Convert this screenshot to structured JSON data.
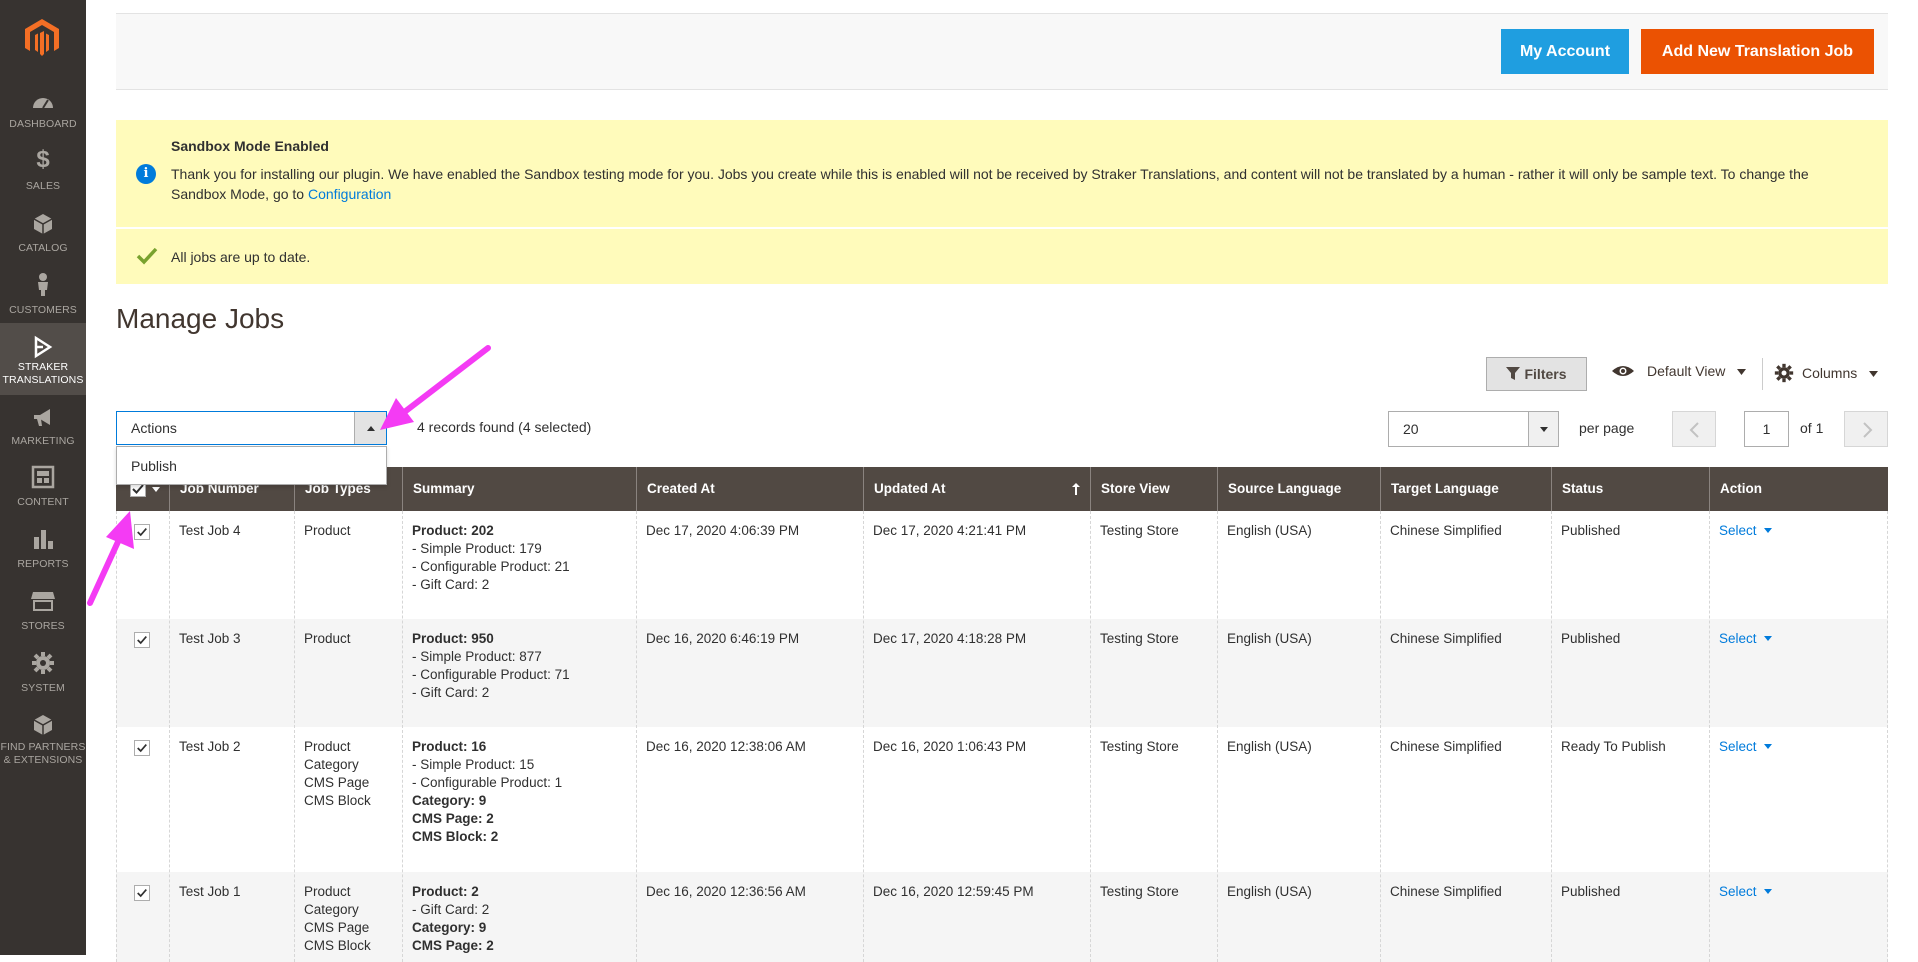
{
  "sidebar": {
    "items": [
      {
        "label": "DASHBOARD",
        "icon": "dashboard-icon"
      },
      {
        "label": "$",
        "icon": "sales-icon"
      },
      {
        "label": "SALES",
        "icon": "sales-icon"
      },
      {
        "label": "CATALOG",
        "icon": "catalog-icon"
      },
      {
        "label": "CUSTOMERS",
        "icon": "customers-icon"
      },
      {
        "label": "STRAKER",
        "label2": "TRANSLATIONS",
        "icon": "straker-icon"
      },
      {
        "label": "MARKETING",
        "icon": "marketing-icon"
      },
      {
        "label": "CONTENT",
        "icon": "content-icon"
      },
      {
        "label": "REPORTS",
        "icon": "reports-icon"
      },
      {
        "label": "STORES",
        "icon": "stores-icon"
      },
      {
        "label": "SYSTEM",
        "icon": "system-icon"
      },
      {
        "label": "FIND PARTNERS",
        "label2": "& EXTENSIONS",
        "icon": "extensions-icon"
      }
    ]
  },
  "header": {
    "account_label": "My Account",
    "add_label": "Add New Translation Job"
  },
  "notices": {
    "sandbox_title": "Sandbox Mode Enabled",
    "sandbox_text": "Thank you for installing our plugin. We have enabled the Sandbox testing mode for you. Jobs you create while this is enabled will not be received by Straker Translations, and content will not be translated by a human - rather it will only be sample text. To change the Sandbox Mode, go to",
    "sandbox_link": "Configuration",
    "status_text": "All jobs are up to date."
  },
  "page_title": "Manage Jobs",
  "toolbar": {
    "filters_label": "Filters",
    "view_label": "Default View",
    "columns_label": "Columns",
    "actions_value": "Actions",
    "actions_options": [
      "Publish"
    ],
    "records_text": "4 records found (4 selected)",
    "per_page_value": "20",
    "per_page_label": "per page",
    "page_current": "1",
    "page_of": "of 1"
  },
  "table": {
    "columns": [
      "Job Number",
      "Job Types",
      "Summary",
      "Created At",
      "Updated At",
      "Store View",
      "Source Language",
      "Target Language",
      "Status",
      "Action"
    ],
    "rows": [
      {
        "job": "Test Job 4",
        "types": [
          "Product"
        ],
        "summary": [
          {
            "text": "Product: 202",
            "bold": true
          },
          {
            "text": " - Simple Product: 179",
            "bold": false
          },
          {
            "text": " - Configurable Product: 21",
            "bold": false
          },
          {
            "text": " - Gift Card: 2",
            "bold": false
          }
        ],
        "created": "Dec 17, 2020 4:06:39 PM",
        "updated": "Dec 17, 2020 4:21:41 PM",
        "store": "Testing Store",
        "source": "English (USA)",
        "target": "Chinese Simplified",
        "status": "Published",
        "action": "Select"
      },
      {
        "job": "Test Job 3",
        "types": [
          "Product"
        ],
        "summary": [
          {
            "text": "Product: 950",
            "bold": true
          },
          {
            "text": " - Simple Product: 877",
            "bold": false
          },
          {
            "text": " - Configurable Product: 71",
            "bold": false
          },
          {
            "text": " - Gift Card: 2",
            "bold": false
          }
        ],
        "created": "Dec 16, 2020 6:46:19 PM",
        "updated": "Dec 17, 2020 4:18:28 PM",
        "store": "Testing Store",
        "source": "English (USA)",
        "target": "Chinese Simplified",
        "status": "Published",
        "action": "Select"
      },
      {
        "job": "Test Job 2",
        "types": [
          "Product",
          "Category",
          "CMS Page",
          "CMS Block"
        ],
        "summary": [
          {
            "text": "Product: 16",
            "bold": true
          },
          {
            "text": " - Simple Product: 15",
            "bold": false
          },
          {
            "text": " - Configurable Product: 1",
            "bold": false
          },
          {
            "text": "Category: 9",
            "bold": true
          },
          {
            "text": "CMS Page: 2",
            "bold": true
          },
          {
            "text": "CMS Block: 2",
            "bold": true
          }
        ],
        "created": "Dec 16, 2020 12:38:06 AM",
        "updated": "Dec 16, 2020 1:06:43 PM",
        "store": "Testing Store",
        "source": "English (USA)",
        "target": "Chinese Simplified",
        "status": "Ready To Publish",
        "action": "Select"
      },
      {
        "job": "Test Job 1",
        "types": [
          "Product",
          "Category",
          "CMS Page",
          "CMS Block"
        ],
        "summary": [
          {
            "text": "Product: 2",
            "bold": true
          },
          {
            "text": " - Gift Card: 2",
            "bold": false
          },
          {
            "text": "Category: 9",
            "bold": true
          },
          {
            "text": "CMS Page: 2",
            "bold": true
          }
        ],
        "created": "Dec 16, 2020 12:36:56 AM",
        "updated": "Dec 16, 2020 12:59:45 PM",
        "store": "Testing Store",
        "source": "English (USA)",
        "target": "Chinese Simplified",
        "status": "Published",
        "action": "Select"
      }
    ]
  },
  "colors": {
    "sidebar_bg": "#373330",
    "accent_orange": "#eb5202",
    "accent_blue": "#1f9ee0",
    "link": "#007bdb",
    "notice_bg": "#fffbbb",
    "table_header": "#514943",
    "annotation_arrow": "#f43bf4"
  }
}
